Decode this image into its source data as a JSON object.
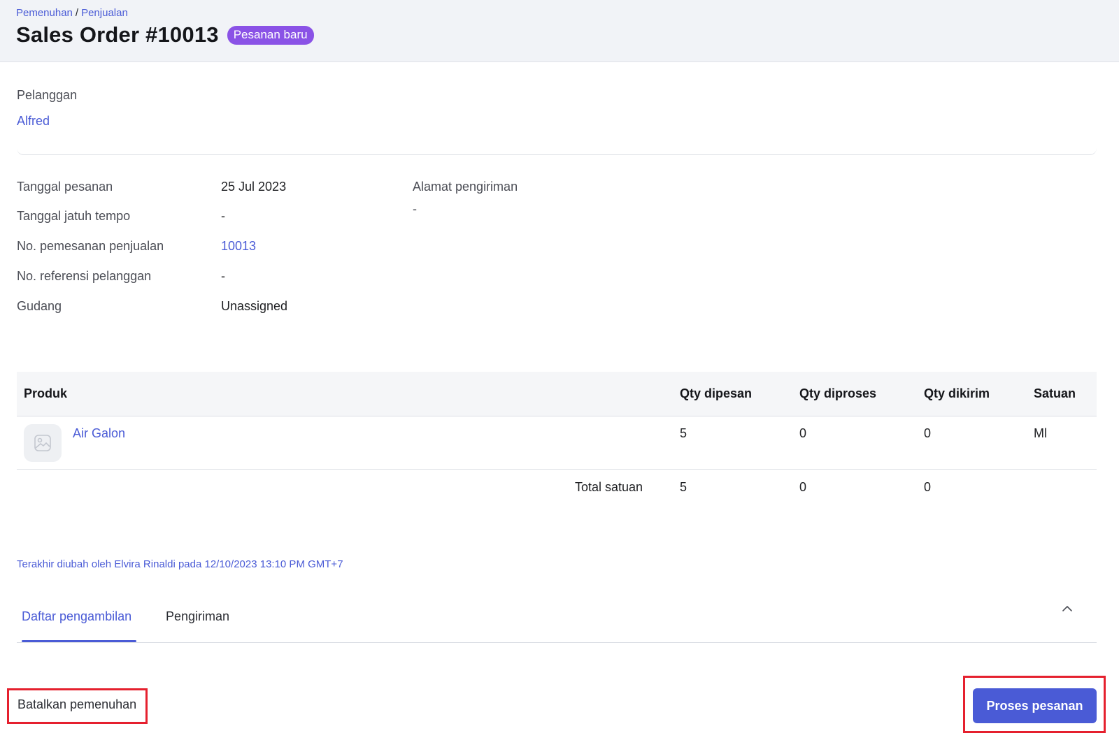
{
  "breadcrumb": {
    "parent": "Pemenuhan",
    "separator": "/",
    "current": "Penjualan"
  },
  "header": {
    "title": "Sales Order #10013",
    "status_badge": "Pesanan baru"
  },
  "customer": {
    "label": "Pelanggan",
    "name": "Alfred"
  },
  "order_info": [
    {
      "label": "Tanggal pesanan",
      "value": "25 Jul 2023",
      "is_link": false
    },
    {
      "label": "Tanggal jatuh tempo",
      "value": "-",
      "is_link": false
    },
    {
      "label": "No. pemesanan penjualan",
      "value": "10013",
      "is_link": true
    },
    {
      "label": "No. referensi pelanggan",
      "value": "-",
      "is_link": false
    },
    {
      "label": "Gudang",
      "value": "Unassigned",
      "is_link": false
    }
  ],
  "shipping": {
    "label": "Alamat pengiriman",
    "value": "-"
  },
  "table": {
    "headers": {
      "product": "Produk",
      "qty_ordered": "Qty dipesan",
      "qty_processed": "Qty diproses",
      "qty_shipped": "Qty dikirim",
      "unit": "Satuan"
    },
    "rows": [
      {
        "product": "Air Galon",
        "image_icon": "image-placeholder-icon",
        "qty_ordered": "5",
        "qty_processed": "0",
        "qty_shipped": "0",
        "unit": "Ml"
      }
    ],
    "totals": {
      "label": "Total satuan",
      "qty_ordered": "5",
      "qty_processed": "0",
      "qty_shipped": "0"
    }
  },
  "modified_note": "Terakhir diubah oleh Elvira Rinaldi pada 12/10/2023 13:10 PM GMT+7",
  "tabs": [
    {
      "label": "Daftar pengambilan",
      "active": true
    },
    {
      "label": "Pengiriman",
      "active": false
    }
  ],
  "actions": {
    "cancel_label": "Batalkan pemenuhan",
    "process_label": "Proses pesanan"
  },
  "colors": {
    "accent": "#4a5bd6",
    "badge": "#8a52e6",
    "highlight": "#e5202e",
    "header_bg": "#f1f3f7"
  }
}
